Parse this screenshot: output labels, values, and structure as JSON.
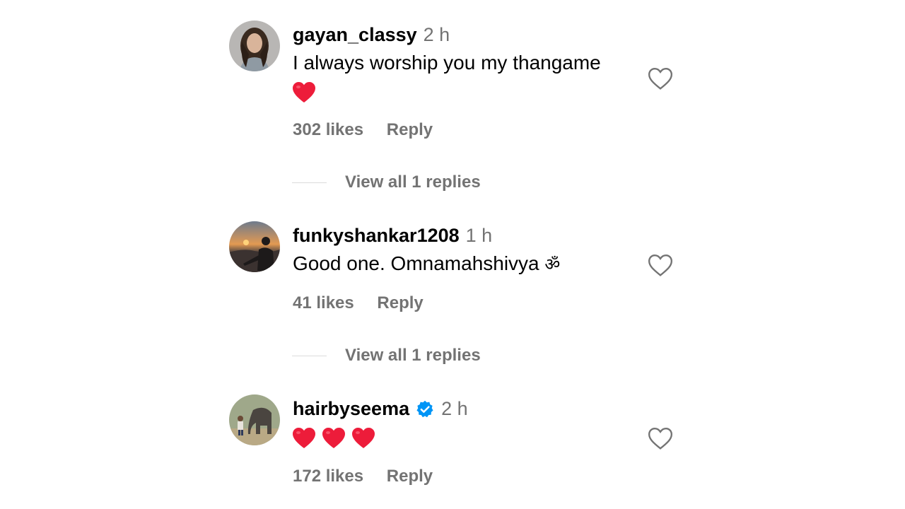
{
  "comments": [
    {
      "username": "gayan_classy",
      "time": "2 h",
      "text": "I always worship you my thangame",
      "emoji": "❤️",
      "likes": "302 likes",
      "reply": "Reply",
      "view_replies": "View all 1 replies",
      "avatar_icon": "avatar-woman-portrait"
    },
    {
      "username": "funkyshankar1208",
      "time": "1 h",
      "text": "Good one. Omnamahshivya",
      "emoji": "ॐ",
      "likes": "41 likes",
      "reply": "Reply",
      "view_replies": "View all 1 replies",
      "avatar_icon": "avatar-sunset-silhouette"
    },
    {
      "username": "hairbyseema",
      "verified": true,
      "time": "2 h",
      "emoji_hearts": [
        "❤️",
        "❤️",
        "❤️"
      ],
      "likes": "172 likes",
      "reply": "Reply",
      "avatar_icon": "avatar-elephant-scene"
    }
  ],
  "colors": {
    "secondary_text": "#737373",
    "heart_red": "#ed1c3a",
    "verified_blue": "#0095f6",
    "divider": "#dbdbdb"
  }
}
